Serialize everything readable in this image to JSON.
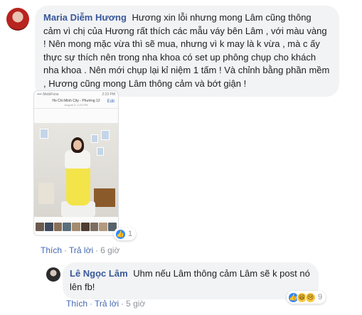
{
  "comment": {
    "author": "Maria Diễm Hương",
    "text": "Hương xin lỗi nhưng mong Lâm cũng thông cảm vì chị của Hương rất thích các mẫu váy bên Lâm , với màu vàng ! Nên mong mặc vừa thì sẽ mua, nhưng vì k may là k vừa , mà c ấy thực sự thích nên trong nha khoa có set up phông chụp cho khách nha khoa . Nên mới chụp lại kỉ niệm 1 tấm ! Và chỉnh bằng phần mềm , Hương cũng mong Lâm thông cảm và bớt giận !",
    "photo": {
      "status_left": "•••• MobiFone",
      "status_right": "2:23 PM",
      "location": "Ho Chi Minh City - Phường 12",
      "date": "August 9, 2:23 PM",
      "edit_label": "Edit"
    },
    "reaction_count": "1",
    "actions": {
      "like": "Thích",
      "reply": "Trả lời",
      "time": "6 giờ"
    }
  },
  "reply": {
    "author": "Lê Ngọc Lâm",
    "text": "Uhm nếu Lâm thông cảm Lâm sẽ k post nó lên fb!",
    "reaction_count": "9",
    "actions": {
      "like": "Thích",
      "reply": "Trả lời",
      "time": "5 giờ"
    }
  },
  "separator": "·",
  "icons": [
    "like-reaction-icon",
    "haha-reaction-icon",
    "sad-reaction-icon"
  ],
  "colors": {
    "link": "#385898",
    "action": "#4267b2",
    "bubble": "#f2f3f5",
    "meta": "#90949c"
  }
}
